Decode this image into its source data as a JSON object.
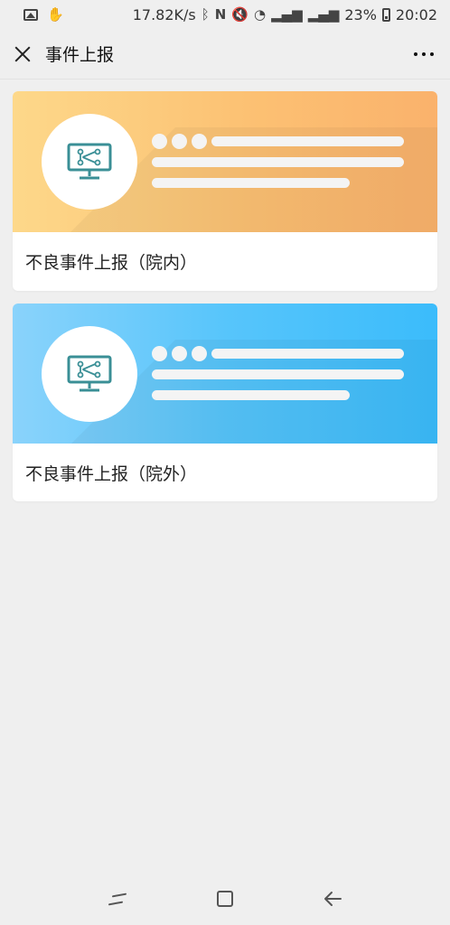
{
  "status_bar": {
    "net_speed": "17.82K/s",
    "battery_pct": "23%",
    "time": "20:02",
    "icons": [
      "image-icon",
      "debug-icon",
      "bluetooth-icon",
      "nfc-icon",
      "mute-icon",
      "wifi-icon",
      "signal-4g-icon",
      "signal-3g-icon",
      "battery-icon"
    ]
  },
  "header": {
    "title": "事件上报"
  },
  "cards": [
    {
      "label": "不良事件上报（院内）",
      "theme": "orange",
      "colors": [
        "#fdd88a",
        "#fab26c"
      ],
      "icon": "monitor-flowchart-icon"
    },
    {
      "label": "不良事件上报（院外）",
      "theme": "blue",
      "colors": [
        "#8ad3fb",
        "#3bbcfb"
      ],
      "icon": "monitor-flowchart-icon"
    }
  ],
  "nav_bar": {
    "icons": [
      "recent-apps-icon",
      "home-icon",
      "back-icon"
    ]
  },
  "colors": {
    "background": "#efefef",
    "icon_stroke": "#3a8f96"
  }
}
